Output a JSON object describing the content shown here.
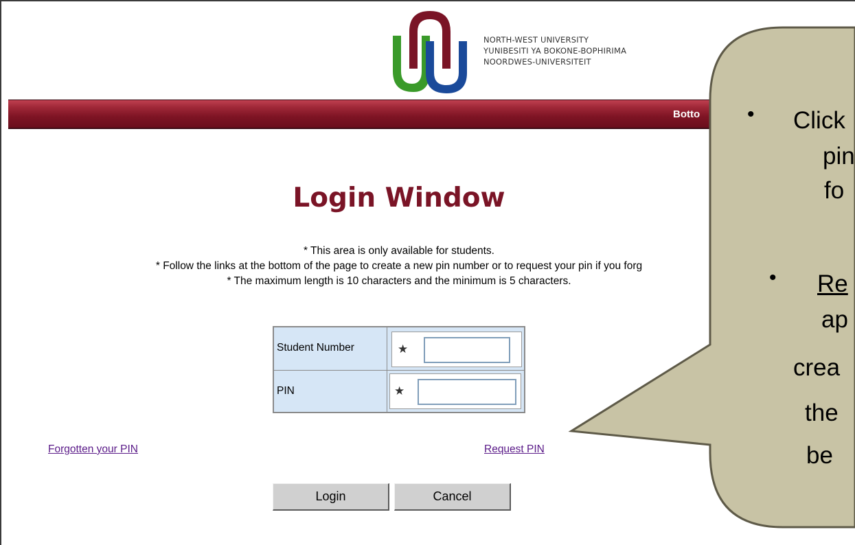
{
  "header": {
    "logo_lines": [
      "NORTH-WEST UNIVERSITY",
      "YUNIBESITI YA BOKONE-BOPHIRIMA",
      "NOORDWES-UNIVERSITEIT"
    ],
    "banner_link": "Botto"
  },
  "page": {
    "title": "Login Window",
    "notes": [
      "* This area is only available for students.",
      "* Follow the links at the bottom of the page to create a new pin number or to request your pin if you forg",
      "* The maximum length is 10 characters and the minimum is 5 characters."
    ]
  },
  "form": {
    "student_number_label": "Student Number",
    "pin_label": "PIN",
    "required_marker": "★",
    "student_number_value": "",
    "pin_value": ""
  },
  "links": {
    "forgotten_pin": "Forgotten your PIN",
    "request_pin": "Request PIN"
  },
  "buttons": {
    "login": "Login",
    "cancel": "Cancel"
  },
  "callout": {
    "bullet": "•",
    "lines_1": [
      "Click",
      "pin",
      "fo"
    ],
    "lines_2": [
      "Re",
      "ap",
      "crea",
      "the",
      "be"
    ]
  },
  "colors": {
    "brand_maroon": "#7a1426",
    "brand_blue": "#1a4a9a",
    "brand_green": "#3a9a2a",
    "table_bg": "#d6e6f6",
    "callout_fill": "#c8c3a5",
    "link_purple": "#5a1a88"
  }
}
